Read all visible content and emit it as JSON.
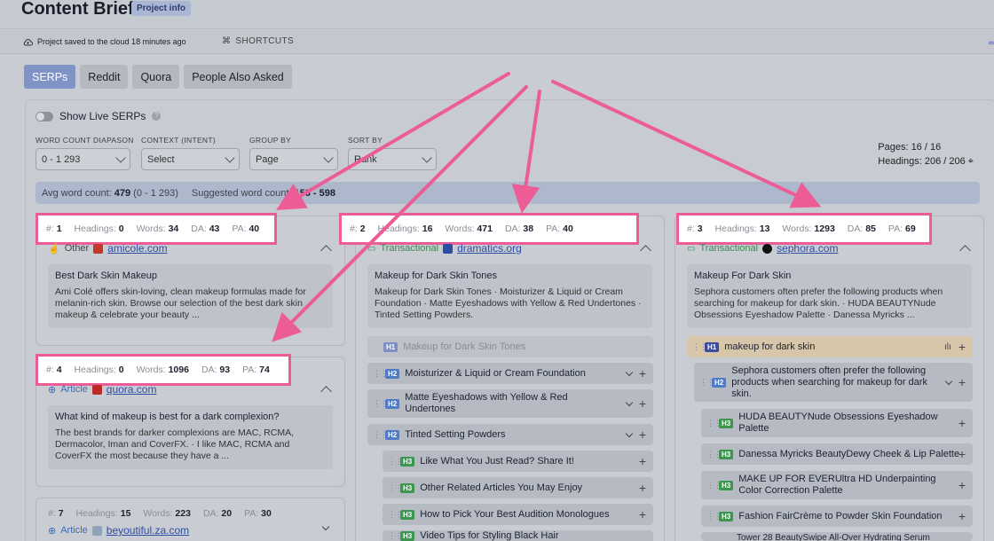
{
  "header": {
    "title": "Content Brief",
    "badge": "Project info"
  },
  "status": {
    "saved": "Project saved to the cloud 18 minutes ago",
    "shortcuts": "SHORTCUTS",
    "right_glyph": "∞"
  },
  "tabs": [
    {
      "label": "SERPs"
    },
    {
      "label": "Reddit"
    },
    {
      "label": "Quora"
    },
    {
      "label": "People Also Asked"
    }
  ],
  "live_serps": {
    "label": "Show Live SERPs"
  },
  "filters": {
    "word_count": {
      "label": "WORD COUNT DIAPASON",
      "value": "0 - 1 293"
    },
    "context": {
      "label": "CONTEXT (INTENT)",
      "value": "Select"
    },
    "group_by": {
      "label": "GROUP BY",
      "value": "Page"
    },
    "sort_by": {
      "label": "SORT BY",
      "value": "Rank"
    }
  },
  "pages": {
    "pages_label": "Pages:",
    "pages_value": "16 / 16",
    "headings_label": "Headings:",
    "headings_value": "206 / 206"
  },
  "wordbar": {
    "avg_label": "Avg word count:",
    "avg_value": "479",
    "avg_range": "(0 - 1 293)",
    "suggested_label": "Suggested word count:",
    "suggested_value": "153 - 598"
  },
  "stat_labels": {
    "num": "#:",
    "headings": "Headings:",
    "words": "Words:",
    "da": "DA:",
    "pa": "PA:"
  },
  "results": [
    {
      "num": "1",
      "headings": "0",
      "words": "34",
      "da": "43",
      "pa": "40",
      "type": "Other",
      "domain": "amicole.com",
      "title": "Best Dark Skin Makeup",
      "desc": "Ami Colé offers skin-loving, clean makeup formulas made for melanin-rich skin. Browse our selection of the best dark skin makeup & celebrate your beauty ..."
    },
    {
      "num": "4",
      "headings": "0",
      "words": "1096",
      "da": "93",
      "pa": "74",
      "type": "Article",
      "domain": "quora.com",
      "title": "What kind of makeup is best for a dark complexion?",
      "desc": "The best brands for darker complexions are MAC, RCMA, Dermacolor, Iman and CoverFX. · I like MAC, RCMA and CoverFX the most because they have a ..."
    },
    {
      "num": "7",
      "headings": "15",
      "words": "223",
      "da": "20",
      "pa": "30",
      "type": "Article",
      "domain": "beyoutiful.za.com"
    },
    {
      "num": "2",
      "headings": "16",
      "words": "471",
      "da": "38",
      "pa": "40",
      "type": "Transactional",
      "domain": "dramatics.org",
      "title": "Makeup for Dark Skin Tones",
      "desc": "Makeup for Dark Skin Tones · Moisturizer & Liquid or Cream Foundation · Matte Eyeshadows with Yellow & Red Undertones · Tinted Setting Powders.",
      "headings_list": [
        {
          "tag": "H1",
          "text": "Makeup for Dark Skin Tones"
        },
        {
          "tag": "H2",
          "text": "Moisturizer & Liquid or Cream Foundation"
        },
        {
          "tag": "H2",
          "text": "Matte Eyeshadows with Yellow & Red Undertones"
        },
        {
          "tag": "H2",
          "text": "Tinted Setting Powders"
        },
        {
          "tag": "H3",
          "text": "Like What You Just Read? Share It!"
        },
        {
          "tag": "H3",
          "text": "Other Related Articles You May Enjoy"
        },
        {
          "tag": "H3",
          "text": "How to Pick Your Best Audition Monologues"
        },
        {
          "tag": "H3",
          "text": "Video Tips for Styling Black Hair"
        }
      ]
    },
    {
      "num": "3",
      "headings": "13",
      "words": "1293",
      "da": "85",
      "pa": "69",
      "type": "Transactional",
      "domain": "sephora.com",
      "title": "Makeup For Dark Skin",
      "desc": "Sephora customers often prefer the following products when searching for makeup for dark skin. · HUDA BEAUTYNude Obsessions Eyeshadow Palette · Danessa Myricks ...",
      "headings_list": [
        {
          "tag": "H1",
          "text": "makeup for dark skin"
        },
        {
          "tag": "H2",
          "text": "Sephora customers often prefer the following products when searching for makeup for dark skin."
        },
        {
          "tag": "H3",
          "text": "HUDA BEAUTYNude Obsessions Eyeshadow Palette"
        },
        {
          "tag": "H3",
          "text": "Danessa Myricks BeautyDewy Cheek & Lip Palette"
        },
        {
          "tag": "H3",
          "text": "MAKE UP FOR EVERUltra HD Underpainting Color Correction Palette"
        },
        {
          "tag": "H3",
          "text": "Fashion FairCrème to Powder Skin Foundation"
        },
        {
          "tag": "H3",
          "text": "Tower 28 BeautySwipe All-Over Hydrating Serum"
        }
      ]
    }
  ],
  "colors": {
    "highlight": "#ec5d97",
    "tab_active": "#7f93c4",
    "h2": "#4f7ac6",
    "h3": "#3d9650"
  }
}
